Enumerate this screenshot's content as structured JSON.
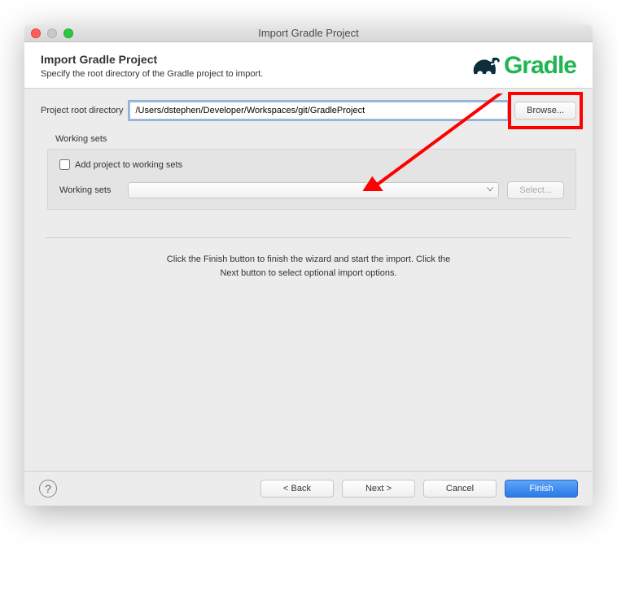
{
  "window": {
    "title": "Import Gradle Project"
  },
  "header": {
    "title": "Import Gradle Project",
    "subtitle": "Specify the root directory of the Gradle project to import.",
    "logo_text": "Gradle"
  },
  "form": {
    "root_dir_label": "Project root directory",
    "root_dir_value": "/Users/dstephen/Developer/Workspaces/git/GradleProject",
    "browse_label": "Browse..."
  },
  "working_sets": {
    "section_label": "Working sets",
    "checkbox_label": "Add project to working sets",
    "select_label": "Working sets",
    "select_button": "Select..."
  },
  "hint": {
    "line1": "Click the Finish button to finish the wizard and start the import. Click the",
    "line2": "Next button to select optional import options."
  },
  "footer": {
    "help": "?",
    "back": "< Back",
    "next": "Next >",
    "cancel": "Cancel",
    "finish": "Finish"
  }
}
